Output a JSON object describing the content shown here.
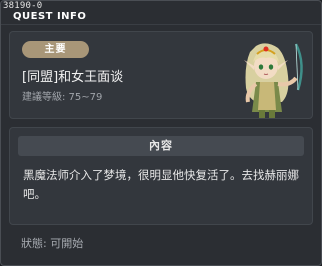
{
  "window": {
    "quest_id": "38190-0",
    "title": "QUEST INFO"
  },
  "quest": {
    "category": "主要",
    "name": "[同盟]和女王面谈",
    "level_text": "建議等級: 75~79",
    "portrait_icon": "elf-queen-portrait-icon"
  },
  "content": {
    "header": "內容",
    "text": "黑魔法师介入了梦境，很明显他快复活了。去找赫丽娜吧。"
  },
  "status": {
    "text": "狀態:  可開始"
  },
  "colors": {
    "badge": "#a89678",
    "panel": "#33373d",
    "background": "#2b2e33"
  }
}
